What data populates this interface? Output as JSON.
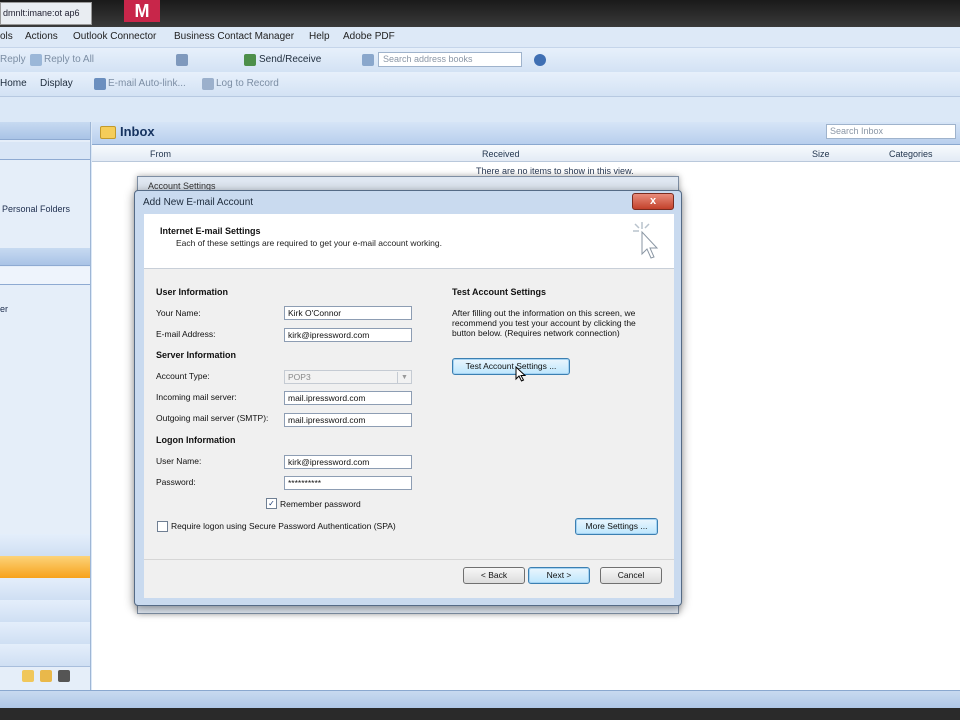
{
  "window": {
    "tab_label": "dmnlt:imane:ot ap6",
    "logo_letter": "M"
  },
  "menubar": {
    "items": [
      "ols",
      "Actions",
      "Outlook Connector",
      "Business Contact Manager",
      "Help",
      "Adobe PDF"
    ]
  },
  "toolbar": {
    "reply": "Reply",
    "reply_all": "Reply to All",
    "send_receive": "Send/Receive",
    "search_placeholder": "Search address books",
    "home": "Home",
    "display": "Display",
    "email_auto_link": "E-mail Auto-link...",
    "log_to_record": "Log to Record"
  },
  "nav": {
    "personal_folders": "Personal Folders",
    "other": "er"
  },
  "inbox": {
    "title": "Inbox",
    "search_placeholder": "Search Inbox",
    "columns": [
      "From",
      "Received",
      "Size",
      "Categories"
    ],
    "empty_message": "There are no items to show in this view."
  },
  "bg_dialog": {
    "title": "Account Settings"
  },
  "dialog": {
    "title": "Add New E-mail Account",
    "close": "x",
    "header_title": "Internet E-mail Settings",
    "header_subtitle": "Each of these settings are required to get your e-mail account working.",
    "user_section": "User Information",
    "your_name_label": "Your Name:",
    "your_name_value": "Kirk O'Connor",
    "email_label": "E-mail Address:",
    "email_value": "kirk@ipressword.com",
    "server_section": "Server Information",
    "account_type_label": "Account Type:",
    "account_type_value": "POP3",
    "incoming_label": "Incoming mail server:",
    "incoming_value": "mail.ipressword.com",
    "outgoing_label": "Outgoing mail server (SMTP):",
    "outgoing_value": "mail.ipressword.com",
    "logon_section": "Logon Information",
    "username_label": "User Name:",
    "username_value": "kirk@ipressword.com",
    "password_label": "Password:",
    "password_value": "**********",
    "remember_password": "Remember password",
    "remember_checked": "✓",
    "spa_label": "Require logon using Secure Password Authentication (SPA)",
    "test_section": "Test Account Settings",
    "test_description_1": "After filling out the information on this screen, we",
    "test_description_2": "recommend you test your account by clicking the",
    "test_description_3": "button below. (Requires network connection)",
    "test_button": "Test Account Settings ...",
    "more_settings": "More Settings ...",
    "back": "< Back",
    "next": "Next >",
    "cancel": "Cancel"
  },
  "colors": {
    "accent": "#f7a21b",
    "frame_blue": "#c9daef"
  }
}
